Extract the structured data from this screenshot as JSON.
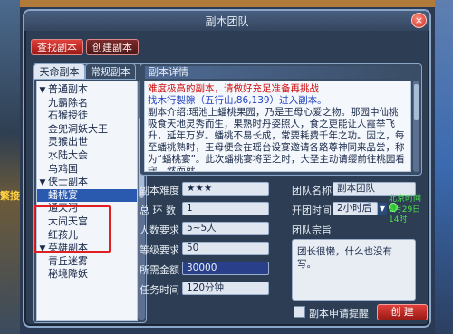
{
  "window": {
    "title": "副本团队",
    "close_symbol": "×"
  },
  "background": {
    "left_text": "繁接",
    "right_text": ""
  },
  "top_tabs": [
    {
      "label": "查找副本",
      "active": true
    },
    {
      "label": "创建副本",
      "active": false
    }
  ],
  "left_tabs": [
    {
      "label": "天命副本",
      "active": true
    },
    {
      "label": "常规副本",
      "active": false
    }
  ],
  "list": [
    {
      "type": "group",
      "label": "普通副本"
    },
    {
      "type": "item",
      "label": "九霸除名"
    },
    {
      "type": "item",
      "label": "石猴授徒"
    },
    {
      "type": "item",
      "label": "金兜洞妖大王"
    },
    {
      "type": "item",
      "label": "灵猴出世"
    },
    {
      "type": "item",
      "label": "水陆大会"
    },
    {
      "type": "item",
      "label": "乌鸡国"
    },
    {
      "type": "group",
      "label": "侠士副本"
    },
    {
      "type": "item",
      "label": "蟠桃宴",
      "selected": true
    },
    {
      "type": "item",
      "label": "通天河"
    },
    {
      "type": "item",
      "label": "大闹天宫"
    },
    {
      "type": "item",
      "label": "红孩儿"
    },
    {
      "type": "group",
      "label": "英雄副本"
    },
    {
      "type": "item",
      "label": "青丘迷雾"
    },
    {
      "type": "item",
      "label": "秘境降妖"
    }
  ],
  "details": {
    "header": "副本详情",
    "warning": "难度极高的副本，请做好充足准备再挑战",
    "location": "找木行製隙（五行山,86,139）进入副本。",
    "body": "副本介绍:瑶池上蟠桃果园，乃是王母心爱之物。那园中仙桃吸食天地灵秀而生，果熟时丹姿照人，食之更能让人霞举飞升，延年万岁。蟠桃不易长成，常要耗费千年之功。因之，每至蟠桃熟时，王母便会在瑶台设宴邀请各路尊神同来品尝，称为“蟠桃宴”。此次蟠桃宴将至之时，大圣主动请缨前往桃园看守，然而就"
  },
  "fields": {
    "difficulty_label": "副本难度",
    "difficulty_value": "★★★",
    "rings_label": "总 环 数",
    "rings_value": "1",
    "people_label": "人数要求",
    "people_value": "5~5人",
    "level_label": "等级要求",
    "level_value": "50",
    "cost_label": "所需金额",
    "cost_value": "30000",
    "time_label": "任务时间",
    "time_value": "120分钟",
    "team_name_label": "团队名称",
    "team_name_value": "副本团队",
    "open_time_label": "开团时间",
    "open_time_value": "2小时后",
    "beijing_time_label": "北京时间",
    "beijing_time_value": "5月29日14时",
    "motto_label": "团队宗旨",
    "motto_value": "团长很懒，什么也没有写。"
  },
  "footer": {
    "apply_label": "副本申请提醒",
    "create_label": "创 建"
  }
}
